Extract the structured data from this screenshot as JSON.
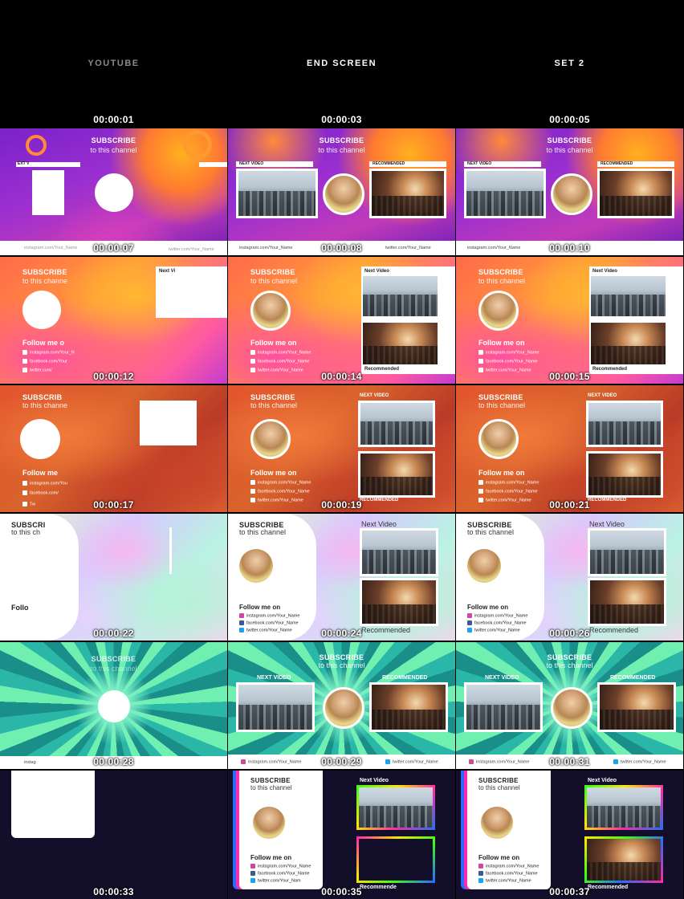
{
  "header": {
    "col1": "YOUTUBE",
    "col2": "END SCREEN",
    "col3": "SET 2"
  },
  "timestamps": {
    "r0": [
      "00:00:01",
      "00:00:03",
      "00:00:05"
    ],
    "r1": [
      "00:00:07",
      "00:00:08",
      "00:00:10"
    ],
    "r2": [
      "00:00:12",
      "00:00:14",
      "00:00:15"
    ],
    "r3": [
      "00:00:17",
      "00:00:19",
      "00:00:21"
    ],
    "r4": [
      "00:00:22",
      "00:00:24",
      "00:00:26"
    ],
    "r5": [
      "00:00:28",
      "00:00:29",
      "00:00:31"
    ],
    "r6": [
      "00:00:33",
      "00:00:35",
      "00:00:37"
    ]
  },
  "text": {
    "subscribe": "SUBSCRIBE",
    "subscribe_title": "Subscribe",
    "to_channel": "to this channel",
    "follow": "Follow me on",
    "next_video": "Next Video",
    "next_video_caps": "NEXT VIDEO",
    "recommended": "Recommended",
    "recommended_caps": "RECOMMENDED",
    "instagram": "instagram.com/Your_Name",
    "facebook": "facebook.com/Your_Name",
    "twitter": "twitter.com/Your_Name"
  },
  "partial": {
    "r1_next": "EXT V",
    "r2_follow": "Follow me o",
    "r2_insta": "instagram.com/Your_N",
    "r2_fb": "facebook.com/Your",
    "r2_tw": "twitter.com/",
    "r2_next": "Next Vi",
    "r2_tochan": "to this channe",
    "r3_sub": "SUBSCRIB",
    "r3_tochan": "to this channe",
    "r3_follow": "Follow me",
    "r3_insta": "instagram.com/You",
    "r3_fb": "facebook.com/",
    "r3_tw": "Tw",
    "r4_sub": "SUBSCRI",
    "r4_tochan": "to this ch",
    "r4_follow": "Follo",
    "r4_recommended": "Recommende",
    "r5_insta": "instag",
    "r6_recommended": "Recommende",
    "r6_tw": "twitter.com/Your_Nam"
  },
  "colors": {
    "accent": "#ffffff",
    "background": "#000000"
  }
}
